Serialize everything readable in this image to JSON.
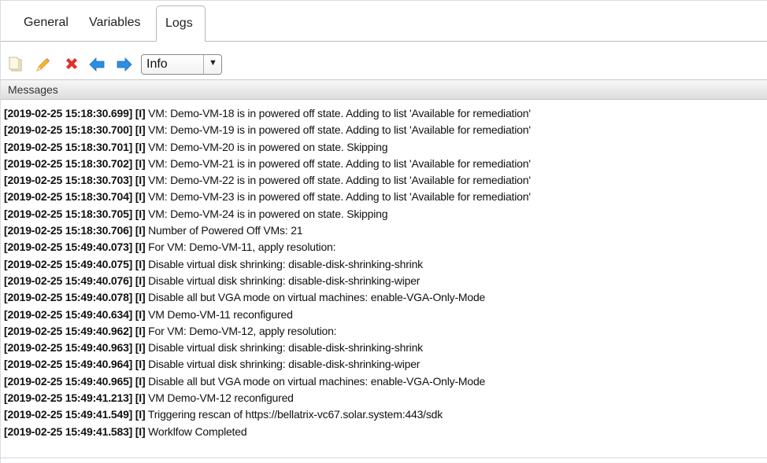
{
  "tabs": [
    {
      "label": "General",
      "active": false
    },
    {
      "label": "Variables",
      "active": false
    },
    {
      "label": "Logs",
      "active": true
    }
  ],
  "toolbar": {
    "icons": [
      "copy-icon",
      "edit-pencil-icon",
      "delete-x-icon",
      "back-arrow-icon",
      "forward-arrow-icon"
    ],
    "level_select": {
      "value": "Info"
    }
  },
  "grid": {
    "header": "Messages",
    "rows": [
      {
        "prefix": "[2019-02-25 15:18:30.699] [I]",
        "message": "VM: Demo-VM-18 is in powered off state. Adding to list 'Available for remediation'"
      },
      {
        "prefix": "[2019-02-25 15:18:30.700] [I]",
        "message": "VM: Demo-VM-19 is in powered off state. Adding to list 'Available for remediation'"
      },
      {
        "prefix": "[2019-02-25 15:18:30.701] [I]",
        "message": "VM: Demo-VM-20 is in powered on state. Skipping"
      },
      {
        "prefix": "[2019-02-25 15:18:30.702] [I]",
        "message": "VM: Demo-VM-21 is in powered off state. Adding to list 'Available for remediation'"
      },
      {
        "prefix": "[2019-02-25 15:18:30.703] [I]",
        "message": "VM: Demo-VM-22 is in powered off state. Adding to list 'Available for remediation'"
      },
      {
        "prefix": "[2019-02-25 15:18:30.704] [I]",
        "message": "VM: Demo-VM-23 is in powered off state. Adding to list 'Available for remediation'"
      },
      {
        "prefix": "[2019-02-25 15:18:30.705] [I]",
        "message": "VM: Demo-VM-24 is in powered on state. Skipping"
      },
      {
        "prefix": "[2019-02-25 15:18:30.706] [I]",
        "message": "Number of Powered Off VMs: 21"
      },
      {
        "prefix": "[2019-02-25 15:49:40.073] [I]",
        "message": "For VM: Demo-VM-11, apply resolution:"
      },
      {
        "prefix": "[2019-02-25 15:49:40.075] [I]",
        "message": "Disable virtual disk shrinking: disable-disk-shrinking-shrink"
      },
      {
        "prefix": "[2019-02-25 15:49:40.076] [I]",
        "message": "Disable virtual disk shrinking: disable-disk-shrinking-wiper"
      },
      {
        "prefix": "[2019-02-25 15:49:40.078] [I]",
        "message": "Disable all but VGA mode on virtual machines: enable-VGA-Only-Mode"
      },
      {
        "prefix": "[2019-02-25 15:49:40.634] [I]",
        "message": "VM Demo-VM-11 reconfigured"
      },
      {
        "prefix": "[2019-02-25 15:49:40.962] [I]",
        "message": "For VM: Demo-VM-12, apply resolution:"
      },
      {
        "prefix": "[2019-02-25 15:49:40.963] [I]",
        "message": "Disable virtual disk shrinking: disable-disk-shrinking-shrink"
      },
      {
        "prefix": "[2019-02-25 15:49:40.964] [I]",
        "message": "Disable virtual disk shrinking: disable-disk-shrinking-wiper"
      },
      {
        "prefix": "[2019-02-25 15:49:40.965] [I]",
        "message": "Disable all but VGA mode on virtual machines: enable-VGA-Only-Mode"
      },
      {
        "prefix": "[2019-02-25 15:49:41.213] [I]",
        "message": "VM Demo-VM-12 reconfigured"
      },
      {
        "prefix": "[2019-02-25 15:49:41.549] [I]",
        "message": "Triggering rescan of https://bellatrix-vc67.solar.system:443/sdk"
      },
      {
        "prefix": "[2019-02-25 15:49:41.583] [I]",
        "message": "Worklfow Completed"
      }
    ]
  }
}
